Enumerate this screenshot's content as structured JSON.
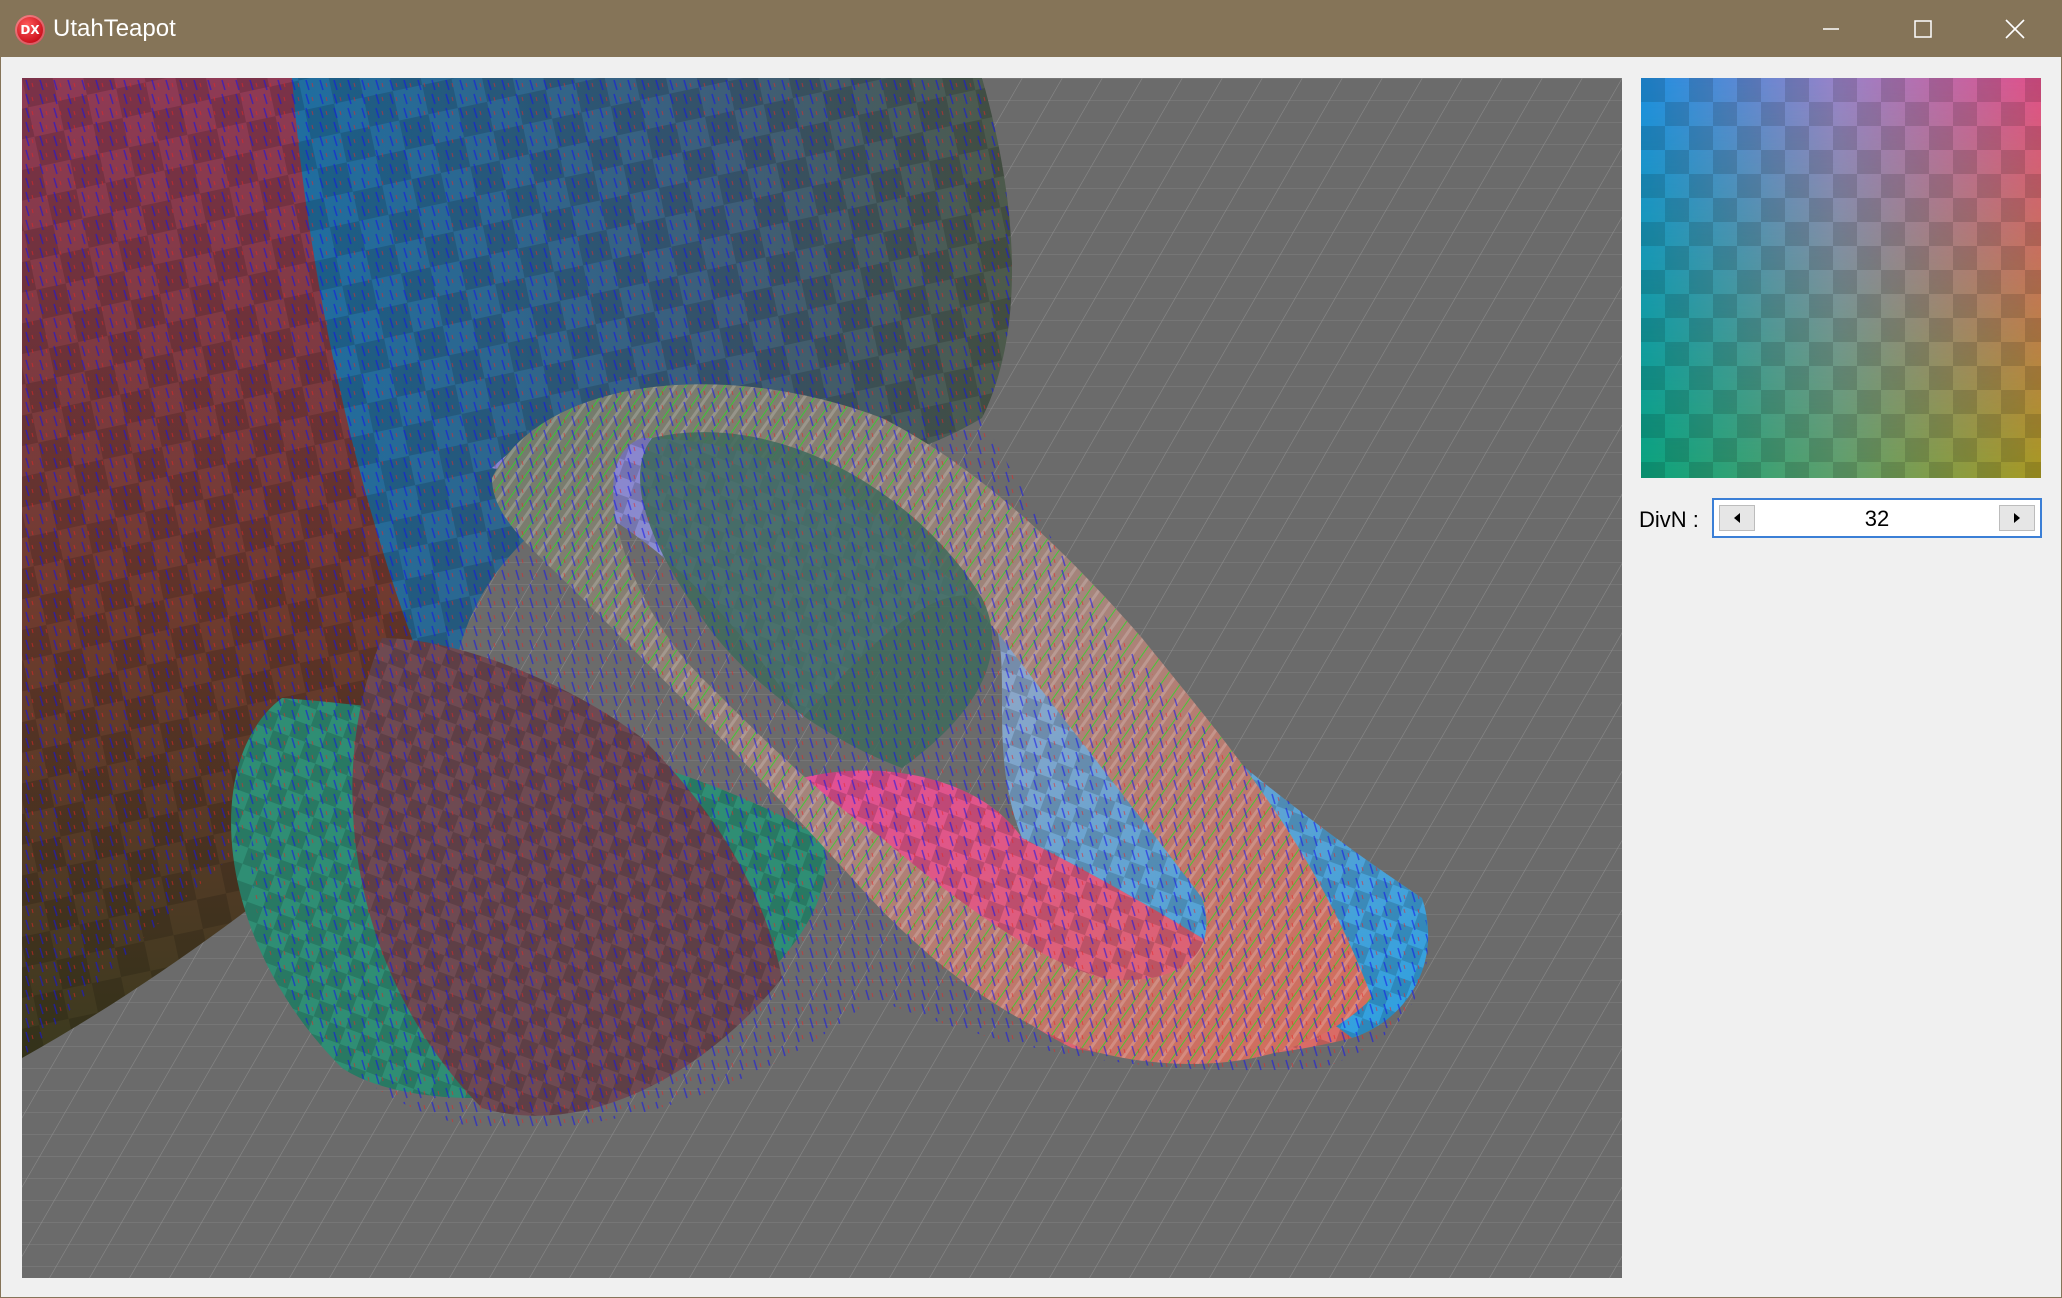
{
  "window": {
    "title": "UtahTeapot",
    "icon_label": "DX",
    "controls": [
      "minimize",
      "maximize",
      "close"
    ]
  },
  "viewport": {
    "description": "3D render of Utah teapot spout/handle region with checkered surface and normal vectors over a grid floor",
    "background": "#6b6b6b",
    "grid_color": "#8a8a8a"
  },
  "palette": {
    "corner_colors": {
      "top_left": "#1e8fe0",
      "top_right": "#e0508a",
      "bottom_left": "#0aa37d",
      "bottom_right": "#a89a22"
    }
  },
  "controls": {
    "divn_label": "DivN :",
    "divn_value": "32"
  },
  "colors": {
    "titlebar": "#857458",
    "panel_bg": "#f0f0f0",
    "focus_border": "#3b7fd6"
  }
}
